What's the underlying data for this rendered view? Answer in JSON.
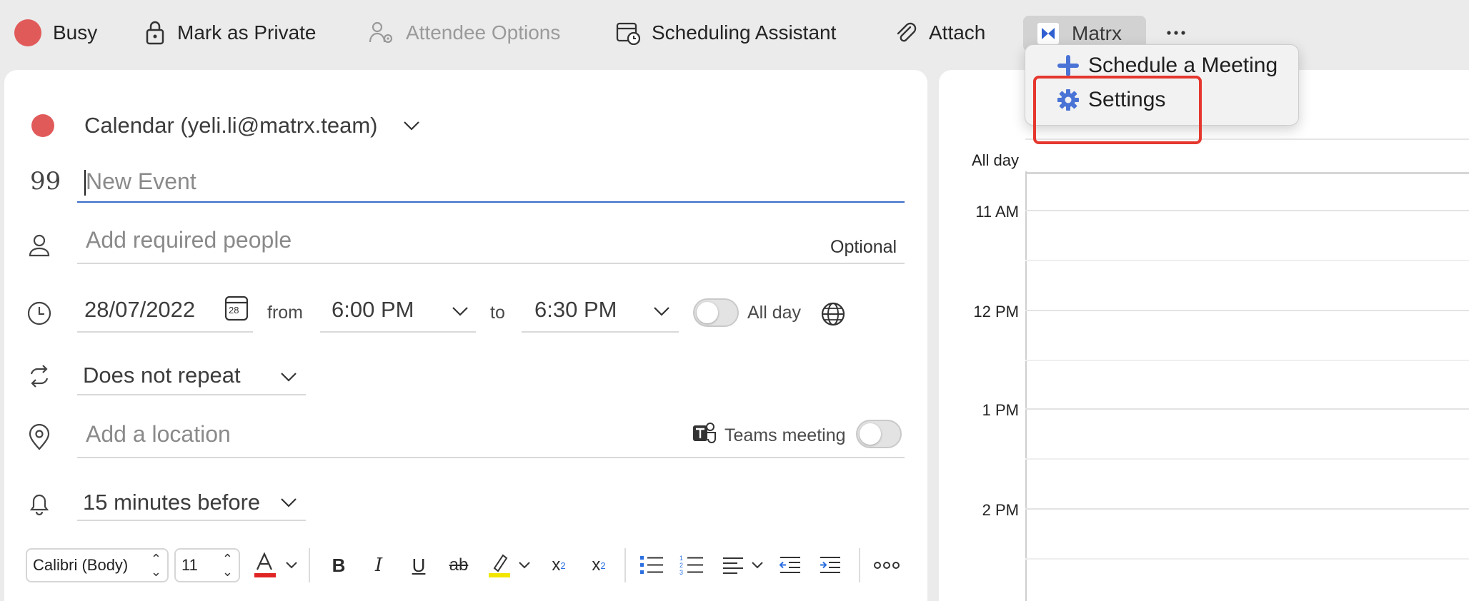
{
  "toolbar": {
    "busy_label": "Busy",
    "private_label": "Mark as Private",
    "attendee_label": "Attendee Options",
    "scheduling_label": "Scheduling Assistant",
    "attach_label": "Attach",
    "matrx_label": "Matrx",
    "busy_color": "#e15a5a"
  },
  "dropdown": {
    "schedule_label": "Schedule a Meeting",
    "settings_label": "Settings"
  },
  "form": {
    "calendar_label": "Calendar (yeli.li@matrx.team)",
    "title_placeholder": "New Event",
    "people_placeholder": "Add required people",
    "optional_label": "Optional",
    "date_value": "28/07/2022",
    "date_icon_day": "28",
    "from_label": "from",
    "start_time": "6:00 PM",
    "to_label": "to",
    "end_time": "6:30 PM",
    "all_day_label": "All day",
    "repeat_value": "Does not repeat",
    "location_placeholder": "Add a location",
    "teams_label": "Teams meeting",
    "reminder_value": "15 minutes before"
  },
  "format_bar": {
    "font_name": "Calibri (Body)",
    "font_size": "11"
  },
  "calendar": {
    "all_day_label": "All day",
    "hours": [
      "11 AM",
      "12 PM",
      "1 PM",
      "2 PM"
    ]
  }
}
